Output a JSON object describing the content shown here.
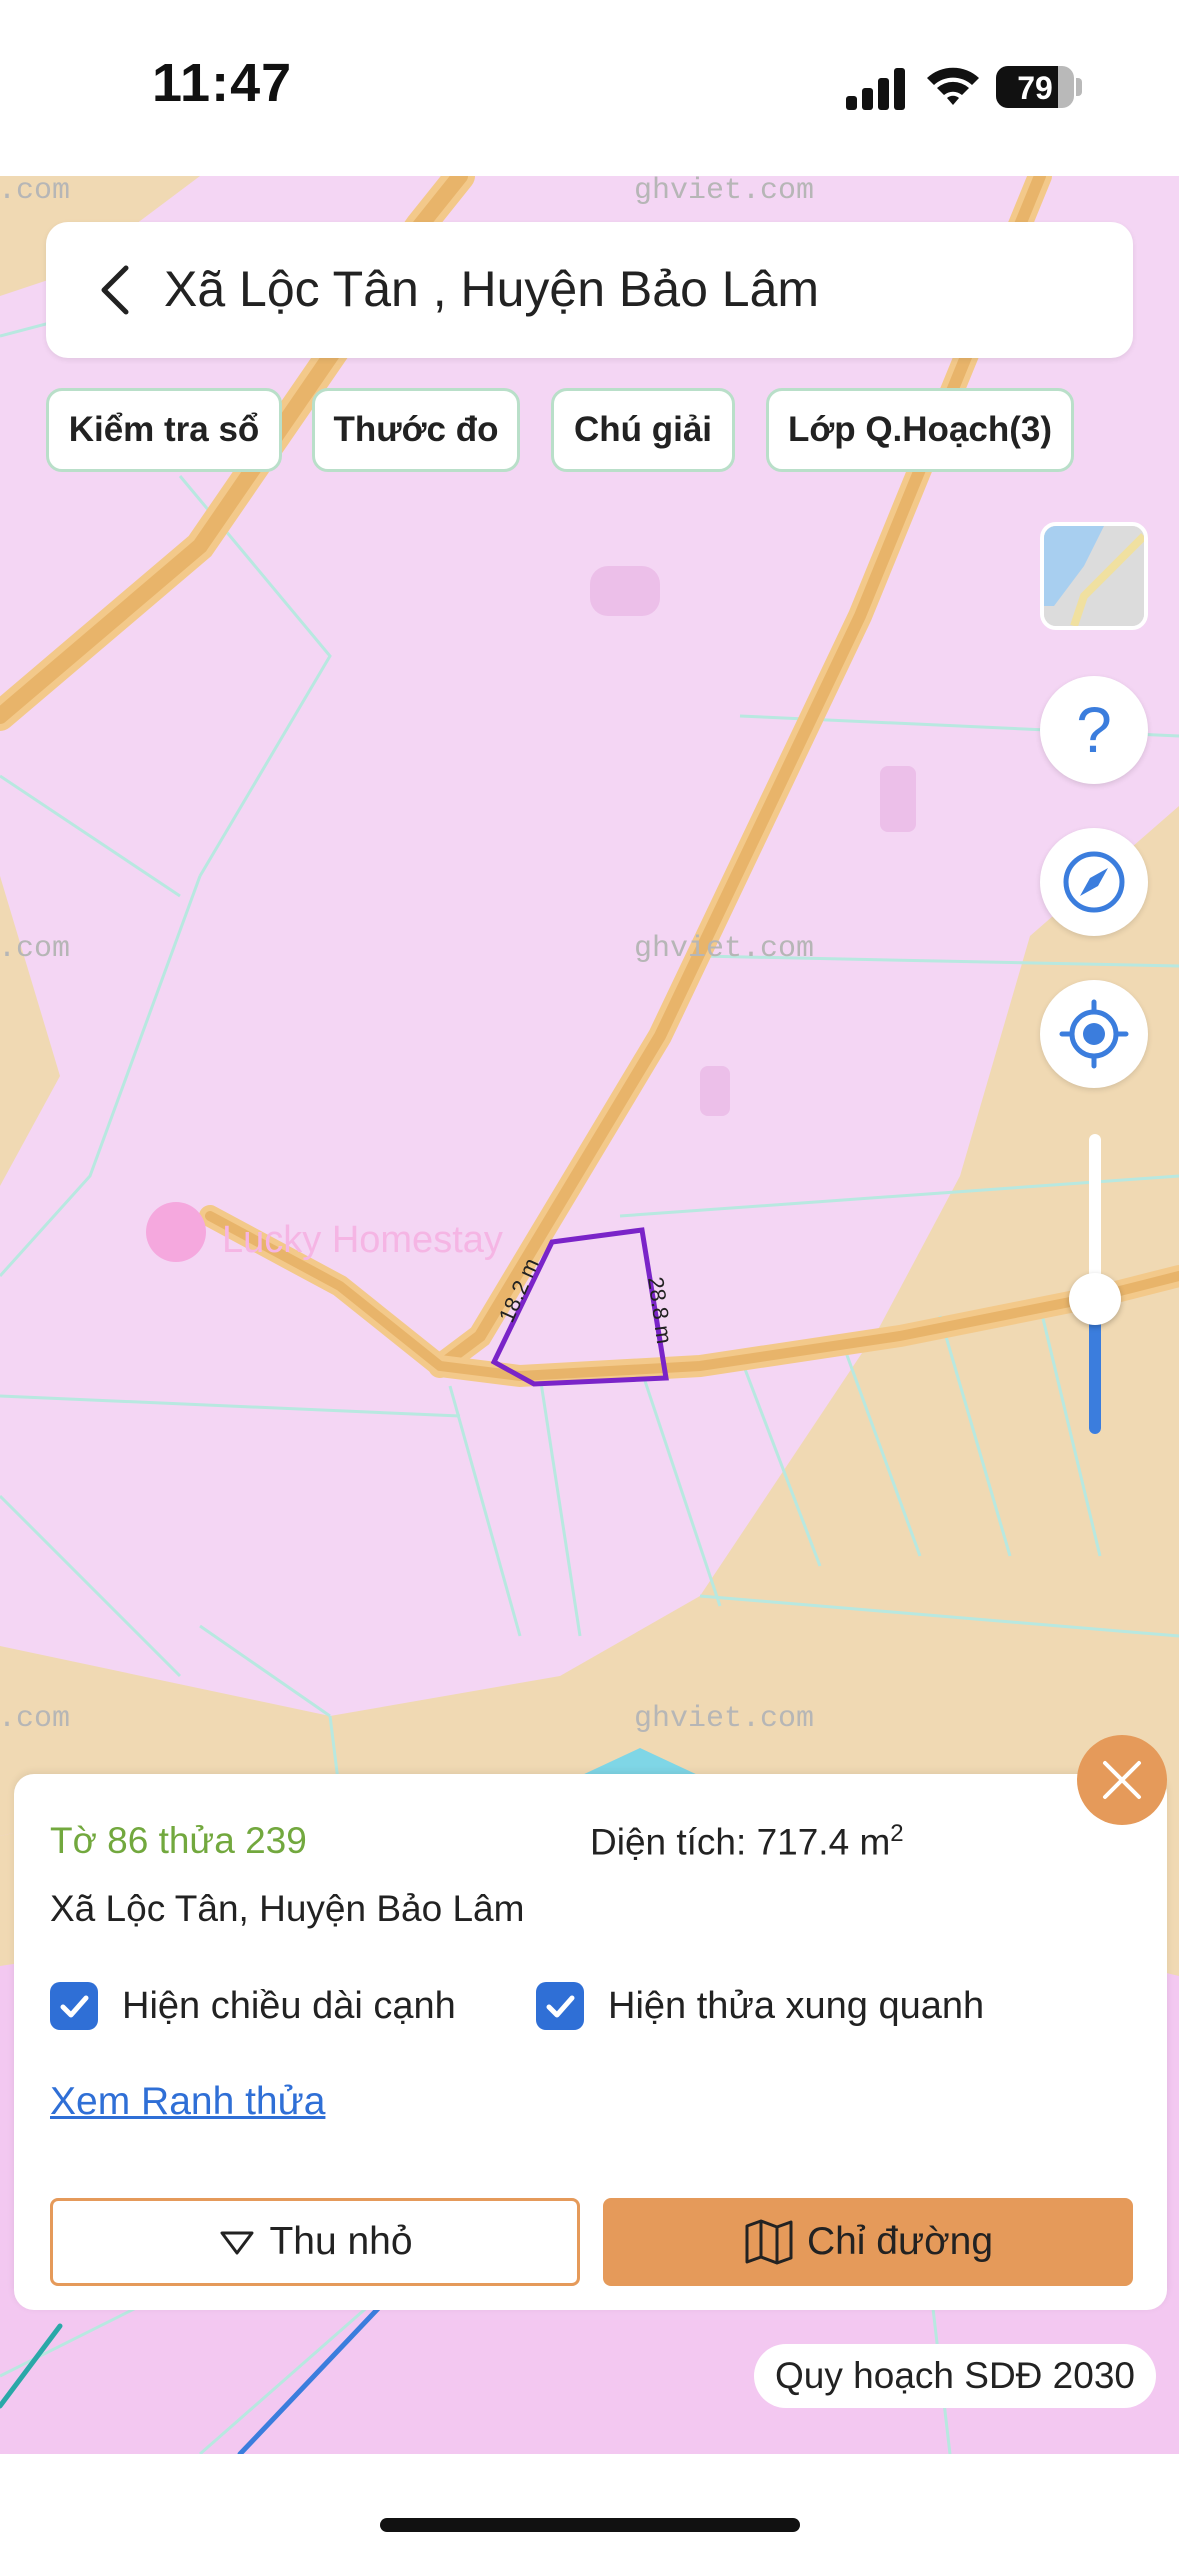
{
  "status_bar": {
    "time": "11:47",
    "battery_level": "79",
    "icons": [
      "cellular-signal-icon",
      "wifi-icon",
      "battery-icon"
    ]
  },
  "header": {
    "title": "Xã Lộc Tân , Huyện Bảo Lâm",
    "back_icon": "chevron-left-icon"
  },
  "chips": [
    {
      "label": "Kiểm tra sổ"
    },
    {
      "label": "Thước đo"
    },
    {
      "label": "Chú giải"
    },
    {
      "label": "Lớp Q.Hoạch(3)"
    }
  ],
  "map": {
    "watermark": "ghviet.com",
    "watermark_edge": ".com",
    "poi_label": "Lucky Homestay",
    "edge_labels": [
      "18.2 m",
      "28.8 m"
    ],
    "colors": {
      "residential": "#f4d6f4",
      "agricultural": "#f0d9b3",
      "road": "#e8b46a",
      "road_edge": "#f3c98a",
      "parcel_lines": "#b8e8e0",
      "selected_parcel": "#7a24c8",
      "water": "#7fd6e6"
    },
    "zoom_level": 0.45
  },
  "controls": {
    "icons": [
      "map-layer-thumbnail",
      "help-icon",
      "compass-icon",
      "locate-icon"
    ],
    "help_glyph": "?"
  },
  "info_card": {
    "parcel": "Tờ 86 thửa 239",
    "area_label": "Diện tích: 717.4 m",
    "area_unit_exp": "2",
    "location": "Xã Lộc Tân, Huyện Bảo Lâm",
    "check1": "Hiện chiều dài cạnh",
    "check2": "Hiện thửa xung quanh",
    "link": "Xem Ranh thửa",
    "btn_shrink": "Thu nhỏ",
    "btn_directions": "Chỉ đường"
  },
  "plan_badge": "Quy hoạch SDĐ 2030"
}
